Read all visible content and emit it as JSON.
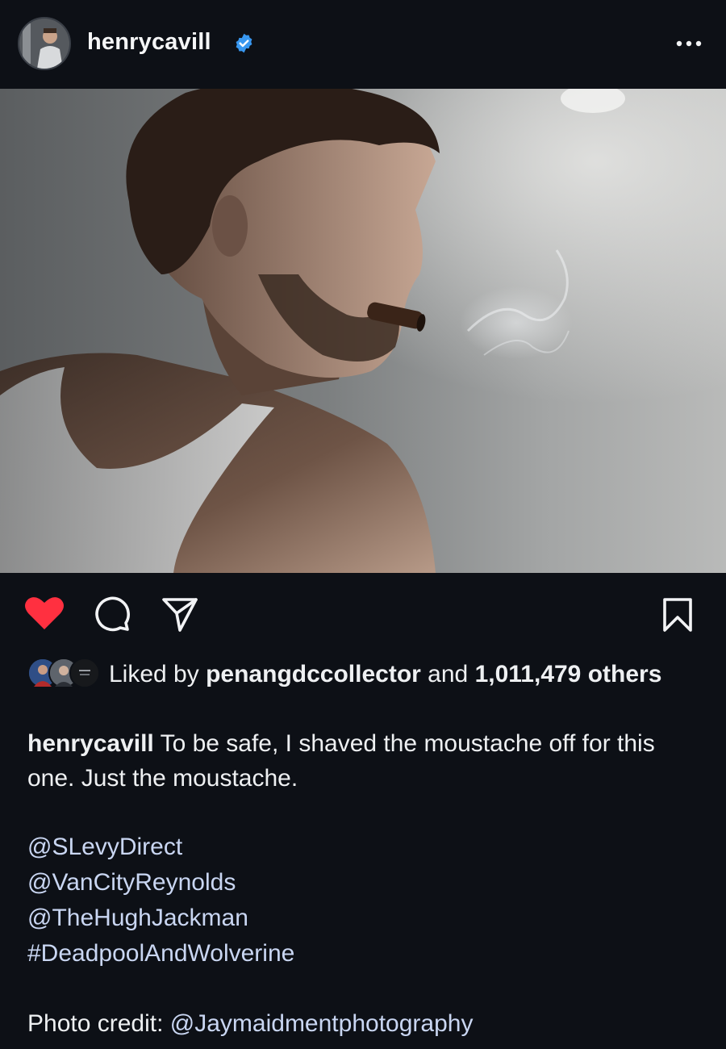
{
  "post": {
    "username": "henrycavill",
    "verified": true,
    "more_icon": "more-dots-icon"
  },
  "photo": {
    "subject": "post-photo"
  },
  "actions": {
    "like_icon": "heart-filled-icon",
    "like_color": "#ff3040",
    "comment_icon": "comment-icon",
    "share_icon": "send-icon",
    "save_icon": "bookmark-icon"
  },
  "likes": {
    "prefix": "Liked by",
    "user": "penangdccollector",
    "conjunction": "and",
    "count": "1,011,479",
    "suffix": "others"
  },
  "caption": {
    "username": "henrycavill",
    "text": "To be safe, I shaved the moustache off for this one. Just the moustache.",
    "tags": [
      "@SLevyDirect",
      "@VanCityReynolds",
      "@TheHughJackman",
      "#DeadpoolAndWolverine"
    ],
    "credit_label": "Photo credit:",
    "credit_handle": "@Jaymaidmentphotography",
    "link_color": "#c9d6f2"
  }
}
